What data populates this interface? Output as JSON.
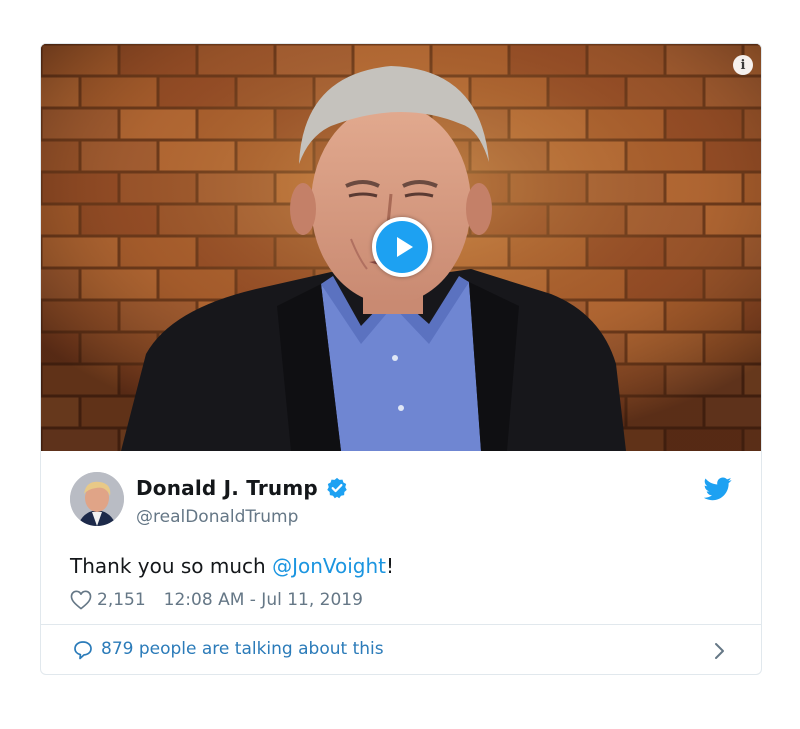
{
  "tweet": {
    "display_name": "Donald J. Trump",
    "handle": "@realDonaldTrump",
    "text_prefix": "Thank you so much ",
    "mention": "@JonVoight",
    "text_suffix": "!",
    "like_count": "2,151",
    "timestamp": "12:08 AM - Jul 11, 2019",
    "verified": true
  },
  "footer": {
    "talking_label": "879 people are talking about this"
  },
  "media": {
    "info_glyph": "i",
    "play_icon": "play-icon"
  },
  "colors": {
    "twitter_blue": "#1da1f2",
    "link_blue": "#1b95e0",
    "muted_text": "#657786",
    "border": "#e1e8ed"
  }
}
